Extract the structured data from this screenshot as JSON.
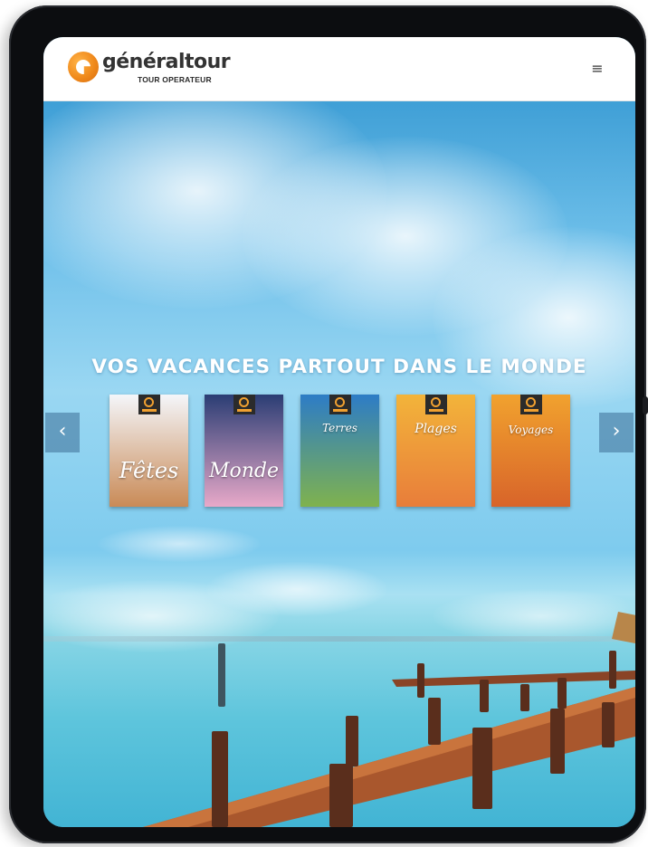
{
  "header": {
    "logo_name": "généraltour",
    "logo_tagline": "TOUR OPERATEUR",
    "menu_icon": "≡"
  },
  "hero": {
    "title": "VOS VACANCES PARTOUT DANS LE MONDE"
  },
  "carousel": {
    "prev_icon": "‹",
    "next_icon": "›",
    "catalogs": [
      {
        "title": "Fêtes",
        "colors": [
          "#f4f6fa",
          "#c98a56"
        ]
      },
      {
        "title": "Monde",
        "colors": [
          "#2a3d74",
          "#e8a9c9"
        ]
      },
      {
        "title": "Terres",
        "colors": [
          "#2d7cc6",
          "#7fb24e"
        ]
      },
      {
        "title": "Plages",
        "colors": [
          "#f3b43a",
          "#e87d3a"
        ]
      },
      {
        "title": "Voyages",
        "colors": [
          "#f1a22e",
          "#d8642a"
        ]
      }
    ]
  },
  "colors": {
    "brand_orange": "#f08a1c",
    "header_bg": "#ffffff",
    "device_frame": "#0c0d10"
  }
}
